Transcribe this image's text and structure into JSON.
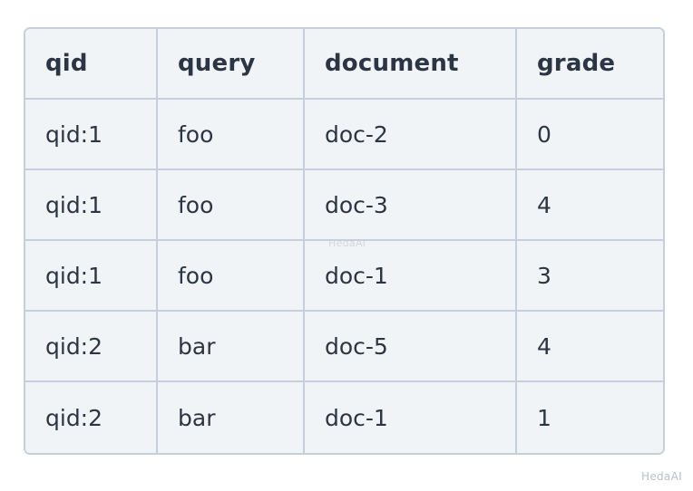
{
  "table": {
    "columns": [
      "qid",
      "query",
      "document",
      "grade"
    ],
    "rows": [
      {
        "qid": "qid:1",
        "query": "foo",
        "document": "doc-2",
        "grade": "0"
      },
      {
        "qid": "qid:1",
        "query": "foo",
        "document": "doc-3",
        "grade": "4"
      },
      {
        "qid": "qid:1",
        "query": "foo",
        "document": "doc-1",
        "grade": "3"
      },
      {
        "qid": "qid:2",
        "query": "bar",
        "document": "doc-5",
        "grade": "4"
      },
      {
        "qid": "qid:2",
        "query": "bar",
        "document": "doc-1",
        "grade": "1"
      }
    ]
  },
  "watermarks": {
    "center": "HedaAI",
    "corner": "HedaAI"
  },
  "colors": {
    "page_background": "#ffffff",
    "cell_background": "#f1f4f7",
    "border": "#c6d0dc",
    "text": "#2c3543",
    "watermark": "#c9ced6"
  }
}
